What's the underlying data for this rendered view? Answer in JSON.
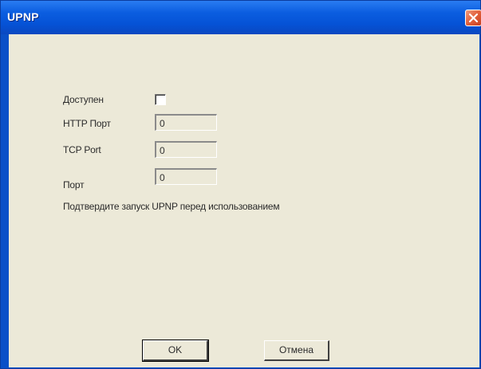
{
  "window": {
    "title": "UPNP",
    "close_icon": "close-icon"
  },
  "form": {
    "enabled_label": "Доступен",
    "enabled_checked": false,
    "http_port_label": "HTTP Порт",
    "http_port_value": "0",
    "tcp_port_label": "TCP Port",
    "tcp_port_value": "0",
    "port_label": "Порт",
    "port_value": "0",
    "note": "Подтвердите запуск UPNP перед использованием"
  },
  "buttons": {
    "ok_label": "OK",
    "cancel_label": "Отмена"
  }
}
